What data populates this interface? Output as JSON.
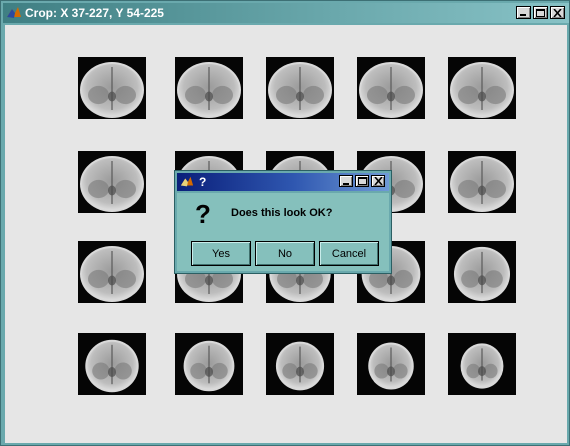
{
  "window": {
    "title": "Crop: X 37-227, Y 54-225"
  },
  "dialog": {
    "title": "?",
    "icon": "question-icon",
    "message": "Does this look OK?",
    "buttons": {
      "yes": "Yes",
      "no": "No",
      "cancel": "Cancel"
    }
  },
  "thumbnails": {
    "rows": 4,
    "cols": 5,
    "content": "coronal brain MRI slices (grayscale)"
  },
  "colors": {
    "window_bg": "#e6e6e6",
    "frame": "#6aa9ad",
    "dialog_body": "#85c0bc",
    "dialog_title": "#0a1f7a"
  }
}
